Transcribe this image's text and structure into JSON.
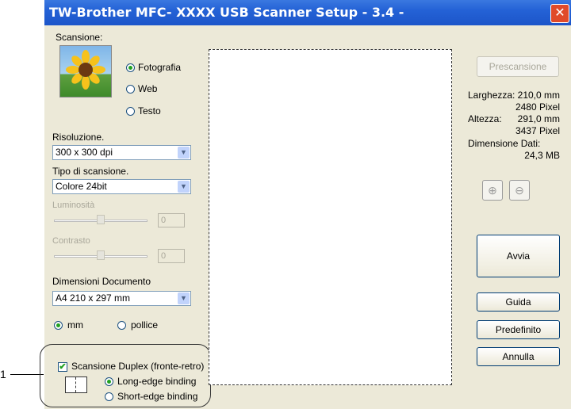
{
  "callout": {
    "label": "1"
  },
  "window": {
    "title": "TW-Brother MFC-  XXXX  USB Scanner Setup - 3.4 -",
    "close_glyph": "✕"
  },
  "scan": {
    "label": "Scansione:",
    "options": [
      "Fotografia",
      "Web",
      "Testo"
    ],
    "selected": "Fotografia"
  },
  "resolution": {
    "label": "Risoluzione.",
    "value": "300 x 300 dpi"
  },
  "scan_type": {
    "label": "Tipo di scansione.",
    "value": "Colore 24bit"
  },
  "brightness": {
    "label": "Luminosità",
    "value": "0"
  },
  "contrast": {
    "label": "Contrasto",
    "value": "0"
  },
  "doc_size": {
    "label": "Dimensioni Documento",
    "value": "A4 210 x 297 mm"
  },
  "units": {
    "options": [
      "mm",
      "pollice"
    ],
    "selected": "mm"
  },
  "duplex": {
    "checkbox_label": "Scansione Duplex (fronte-retro)",
    "checked": true,
    "options": [
      "Long-edge binding",
      "Short-edge binding"
    ],
    "selected": "Long-edge binding"
  },
  "right_panel": {
    "prescan": "Prescansione",
    "width_label": "Larghezza:",
    "width_mm": "210,0 mm",
    "width_px": "2480 Pixel",
    "height_label": "Altezza:",
    "height_mm": "291,0 mm",
    "height_px": "3437 Pixel",
    "data_label": "Dimensione Dati:",
    "data_value": "24,3 MB",
    "start": "Avvia",
    "help": "Guida",
    "default": "Predefinito",
    "cancel": "Annulla"
  },
  "icons": [
    "sunflower-icon",
    "zoom-in-icon",
    "zoom-out-icon",
    "binding-icon",
    "close-icon"
  ],
  "colors": {
    "titlebar": "#2462d6",
    "window_bg": "#ece9d8",
    "radio_dot": "#21a121",
    "close": "#e04a2a"
  }
}
